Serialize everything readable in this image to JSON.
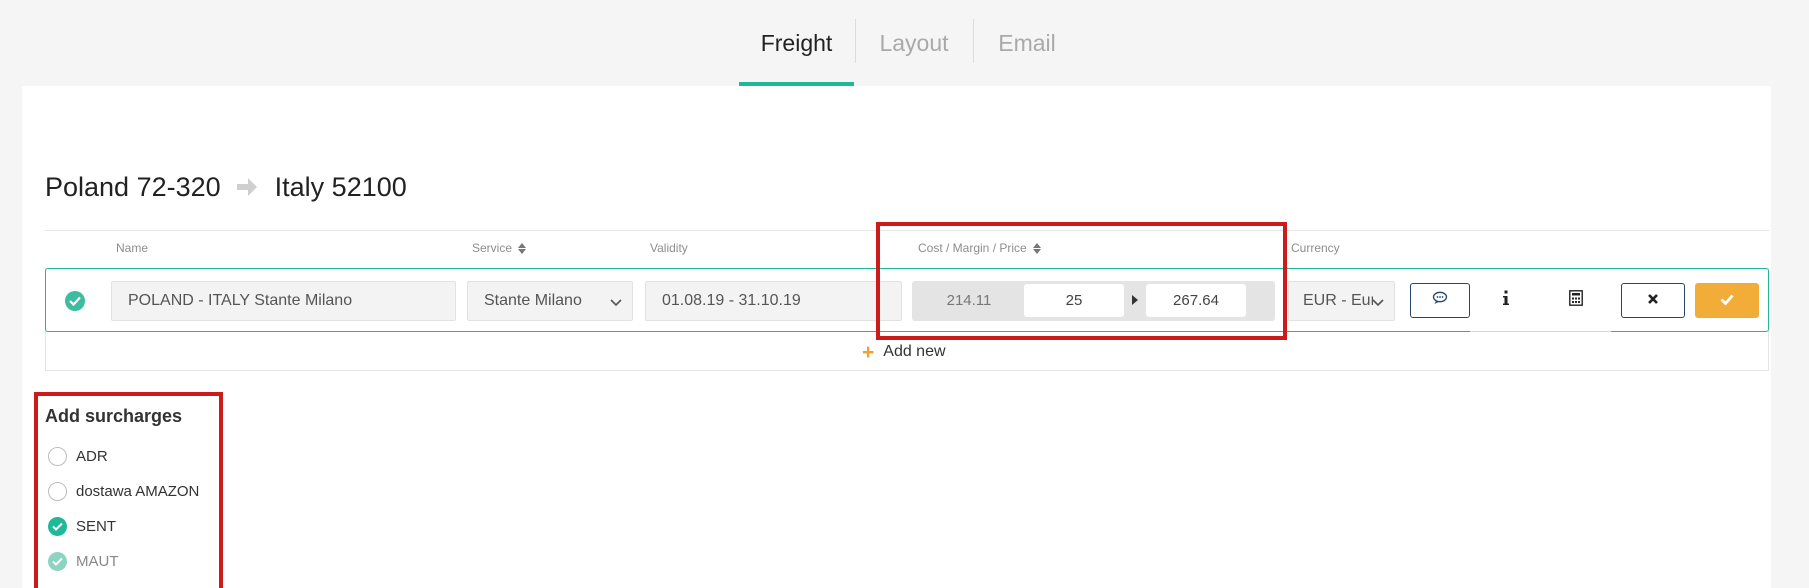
{
  "tabs": [
    {
      "label": "Freight",
      "active": true
    },
    {
      "label": "Layout",
      "active": false
    },
    {
      "label": "Email",
      "active": false
    }
  ],
  "route": {
    "origin": "Poland 72-320",
    "destination": "Italy 52100"
  },
  "columns": {
    "name": "Name",
    "service": "Service",
    "validity": "Validity",
    "cost_margin_price": "Cost / Margin / Price",
    "currency": "Currency"
  },
  "row": {
    "name": "POLAND - ITALY Stante Milano",
    "service": "Stante Milano",
    "validity": "01.08.19 - 31.10.19",
    "cost": "214.11",
    "margin": "25",
    "price": "267.64",
    "currency": "EUR - Euro"
  },
  "add_new": "Add new",
  "surcharges": {
    "title": "Add surcharges",
    "items": [
      {
        "label": "ADR",
        "checked": false
      },
      {
        "label": "dostawa AMAZON",
        "checked": false
      },
      {
        "label": "SENT",
        "checked": true
      },
      {
        "label": "MAUT",
        "checked": true
      }
    ]
  },
  "colors": {
    "accent": "#1fb899",
    "confirm": "#f2ad39",
    "highlight": "#cc1b1b",
    "button_border": "#27466b"
  }
}
